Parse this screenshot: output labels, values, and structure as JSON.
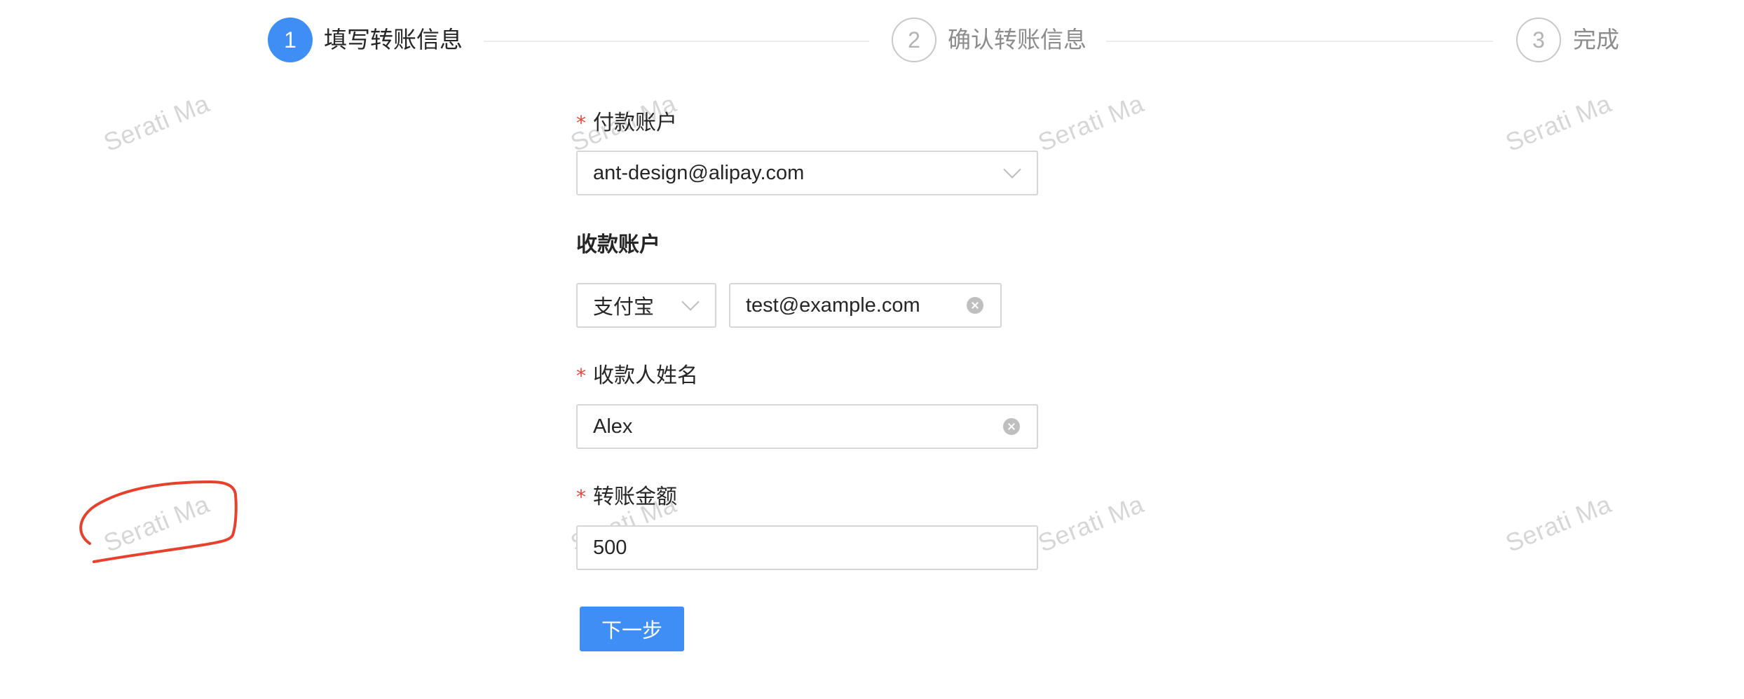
{
  "watermark": {
    "text": "Serati Ma"
  },
  "steps": [
    {
      "number": "1",
      "title": "填写转账信息",
      "status": "active"
    },
    {
      "number": "2",
      "title": "确认转账信息",
      "status": "wait"
    },
    {
      "number": "3",
      "title": "完成",
      "status": "wait"
    }
  ],
  "form": {
    "pay_account": {
      "label": "付款账户",
      "required_mark": "*",
      "value": "ant-design@alipay.com",
      "icon": "chevron-down-icon"
    },
    "receive_account": {
      "label": "收款账户",
      "type_value": "支付宝",
      "account_value": "test@example.com",
      "icon": "clear-icon"
    },
    "receiver_name": {
      "label": "收款人姓名",
      "required_mark": "*",
      "value": "Alex",
      "icon": "clear-icon"
    },
    "amount": {
      "label": "转账金额",
      "required_mark": "*",
      "value": "500"
    },
    "next_button": {
      "label": "下一步"
    }
  },
  "colors": {
    "primary": "#3f8ef5",
    "required": "#e5473a",
    "annotation": "#e5412d",
    "border": "#d6d6d6"
  }
}
